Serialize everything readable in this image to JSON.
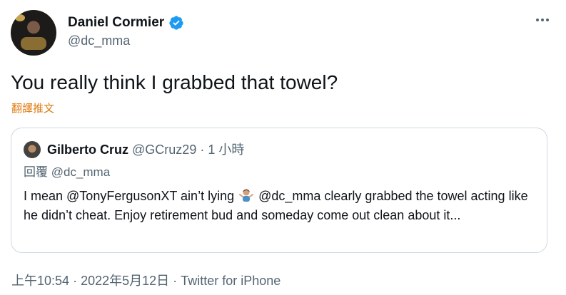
{
  "author": {
    "display_name": "Daniel Cormier",
    "handle": "@dc_mma",
    "verified_icon": "verified-badge-icon",
    "avatar_icon": "avatar"
  },
  "tweet": {
    "text": "You really think I grabbed that towel?",
    "translate_label": "翻譯推文"
  },
  "quoted_tweet": {
    "author_name": "Gilberto Cruz",
    "handle": "@GCruz29",
    "separator": "·",
    "time": "1 小時",
    "reply_prefix": "回覆",
    "reply_handle": "@dc_mma",
    "body_part1": "I mean @TonyFergusonXT ain’t lying",
    "emoji_icon": "person-shrugging-emoji-icon",
    "body_part2": "@dc_mma clearly grabbed the towel acting like he didn’t cheat. Enjoy retirement bud and someday come out clean about it..."
  },
  "meta": {
    "time": "上午10:54",
    "separator": "·",
    "date": "2022年5月12日",
    "source": "Twitter for iPhone"
  },
  "colors": {
    "verified_blue": "#1d9bf0",
    "translate_orange": "#e07a0e",
    "secondary_text": "#536471",
    "border": "#cfd9de"
  }
}
